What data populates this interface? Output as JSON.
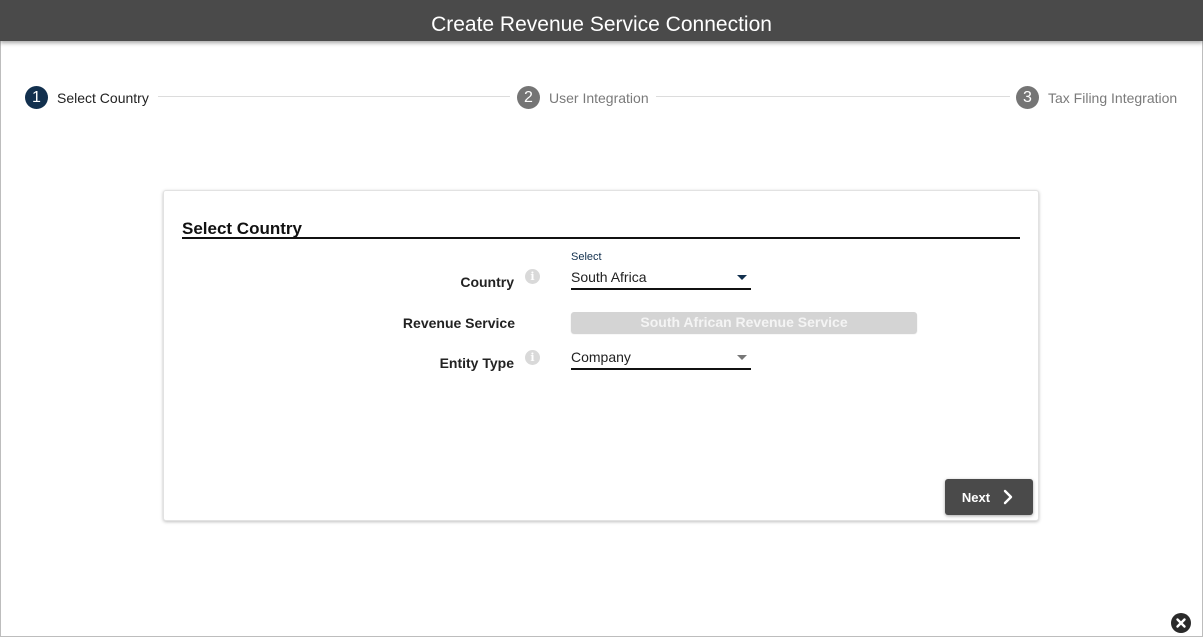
{
  "window": {
    "title": "Create Revenue Service Connection"
  },
  "stepper": {
    "steps": [
      {
        "number": "1",
        "label": "Select Country",
        "active": true
      },
      {
        "number": "2",
        "label": "User Integration",
        "active": false
      },
      {
        "number": "3",
        "label": "Tax Filing Integration",
        "active": false
      }
    ]
  },
  "card": {
    "title": "Select Country",
    "country": {
      "label": "Country",
      "floating_label": "Select",
      "value": "South Africa"
    },
    "revenue_service": {
      "label": "Revenue Service",
      "value": "South African Revenue Service"
    },
    "entity_type": {
      "label": "Entity Type",
      "value": "Company"
    },
    "next_label": "Next"
  },
  "icons": {
    "info": "info-icon",
    "dropdown": "caret-down-icon",
    "next": "chevron-right-icon",
    "close": "close-icon"
  },
  "colors": {
    "header": "#4a4a4a",
    "active_step": "#12304e",
    "inactive_step": "#757575"
  }
}
